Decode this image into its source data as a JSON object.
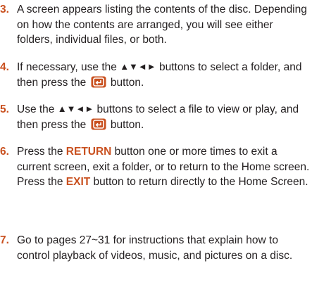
{
  "steps": [
    {
      "number": "3.",
      "text": "A screen appears listing the contents of the disc. Depending on how the contents are arranged, you will see either folders, individual files, or both."
    },
    {
      "number": "4.",
      "text_before": "If necessary, use the ",
      "arrows": "▲▼◄►",
      "text_mid": " buttons to select a folder, and then press the ",
      "text_after": " button."
    },
    {
      "number": "5.",
      "text_before": "Use the ",
      "arrows": "▲▼◄►",
      "text_mid": " buttons to select a file to view or play, and then press the ",
      "text_after": " button."
    },
    {
      "number": "6.",
      "p1_before": "Press the ",
      "p1_keyword": "RETURN",
      "p1_after": " button one or more times to exit a current screen, exit a folder, or to return to the Home screen.",
      "p2_before": "Press the ",
      "p2_keyword": "EXIT",
      "p2_after": " button to return directly to the Home Screen."
    },
    {
      "number": "7.",
      "text": "Go to pages 27~31 for instructions that explain how to control playback of videos, music, and pictures on a disc."
    }
  ],
  "icons": {
    "enter": "enter-button-icon",
    "accent_color": "#c9501f",
    "icon_color": "#c9501f"
  }
}
